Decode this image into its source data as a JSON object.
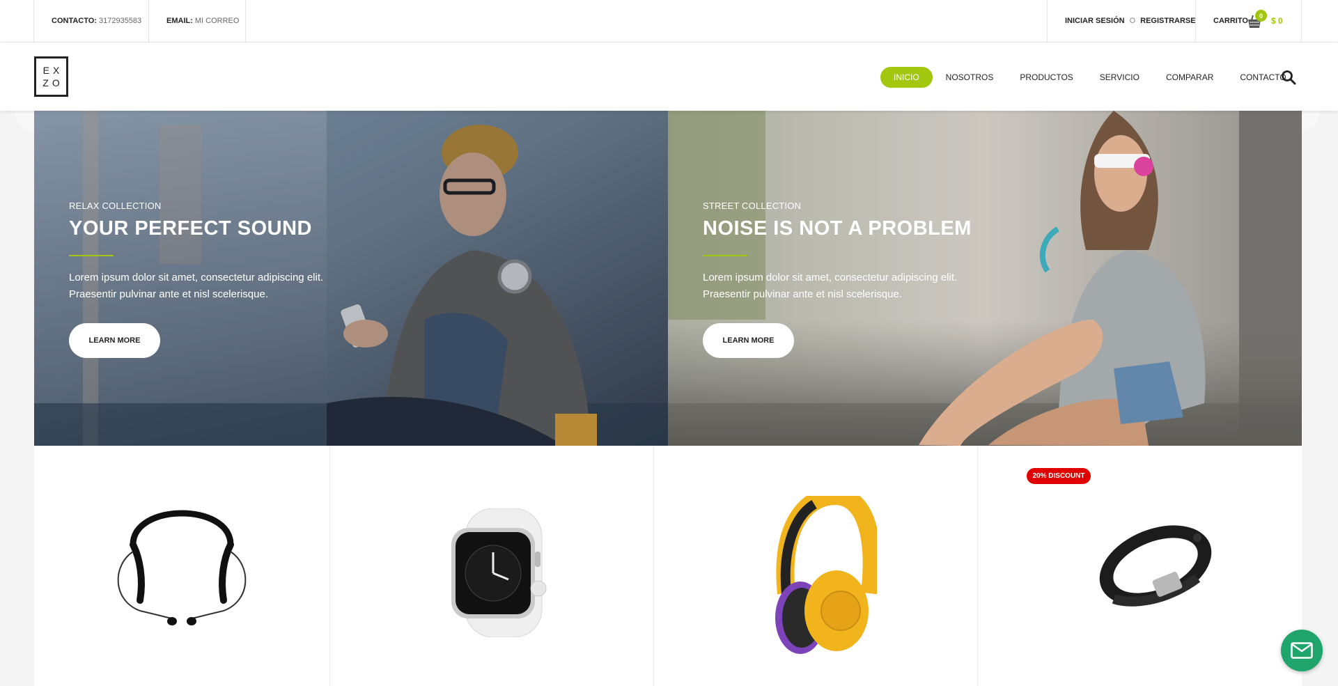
{
  "topbar": {
    "contact_label": "CONTACTO:",
    "contact_value": "3172935583",
    "email_label": "EMAIL:",
    "email_value": "MI CORREO",
    "login": "INICIAR SESIÓN",
    "or": "O",
    "register": "REGISTRARSE",
    "cart_label": "CARRITO",
    "cart_count": "0",
    "cart_total": "$ 0"
  },
  "logo": {
    "line1": "EX",
    "line2": "ZO"
  },
  "nav": {
    "items": [
      {
        "label": "INICIO",
        "active": true
      },
      {
        "label": "NOSOTROS"
      },
      {
        "label": "PRODUCTOS"
      },
      {
        "label": "SERVICIO"
      },
      {
        "label": "COMPARAR"
      },
      {
        "label": "CONTACTO"
      }
    ]
  },
  "hero": {
    "panels": [
      {
        "subtitle": "RELAX COLLECTION",
        "title": "YOUR PERFECT SOUND",
        "description": "Lorem ipsum dolor sit amet, consectetur adipiscing elit. Praesentir pulvinar ante et nisl scelerisque.",
        "button": "LEARN MORE"
      },
      {
        "subtitle": "STREET COLLECTION",
        "title": "NOISE IS NOT A PROBLEM",
        "description": "Lorem ipsum dolor sit amet, consectetur adipiscing elit. Praesentir pulvinar ante et nisl scelerisque.",
        "button": "LEARN MORE"
      }
    ]
  },
  "products": {
    "items": [
      {
        "icon": "neckband-headphones-icon"
      },
      {
        "icon": "smartwatch-icon"
      },
      {
        "icon": "over-ear-headphones-icon"
      },
      {
        "icon": "fitness-band-icon",
        "badge": "20% DISCOUNT"
      }
    ]
  },
  "colors": {
    "accent": "#a3c60f",
    "discount": "#e10000",
    "chat": "#1fa56c"
  }
}
